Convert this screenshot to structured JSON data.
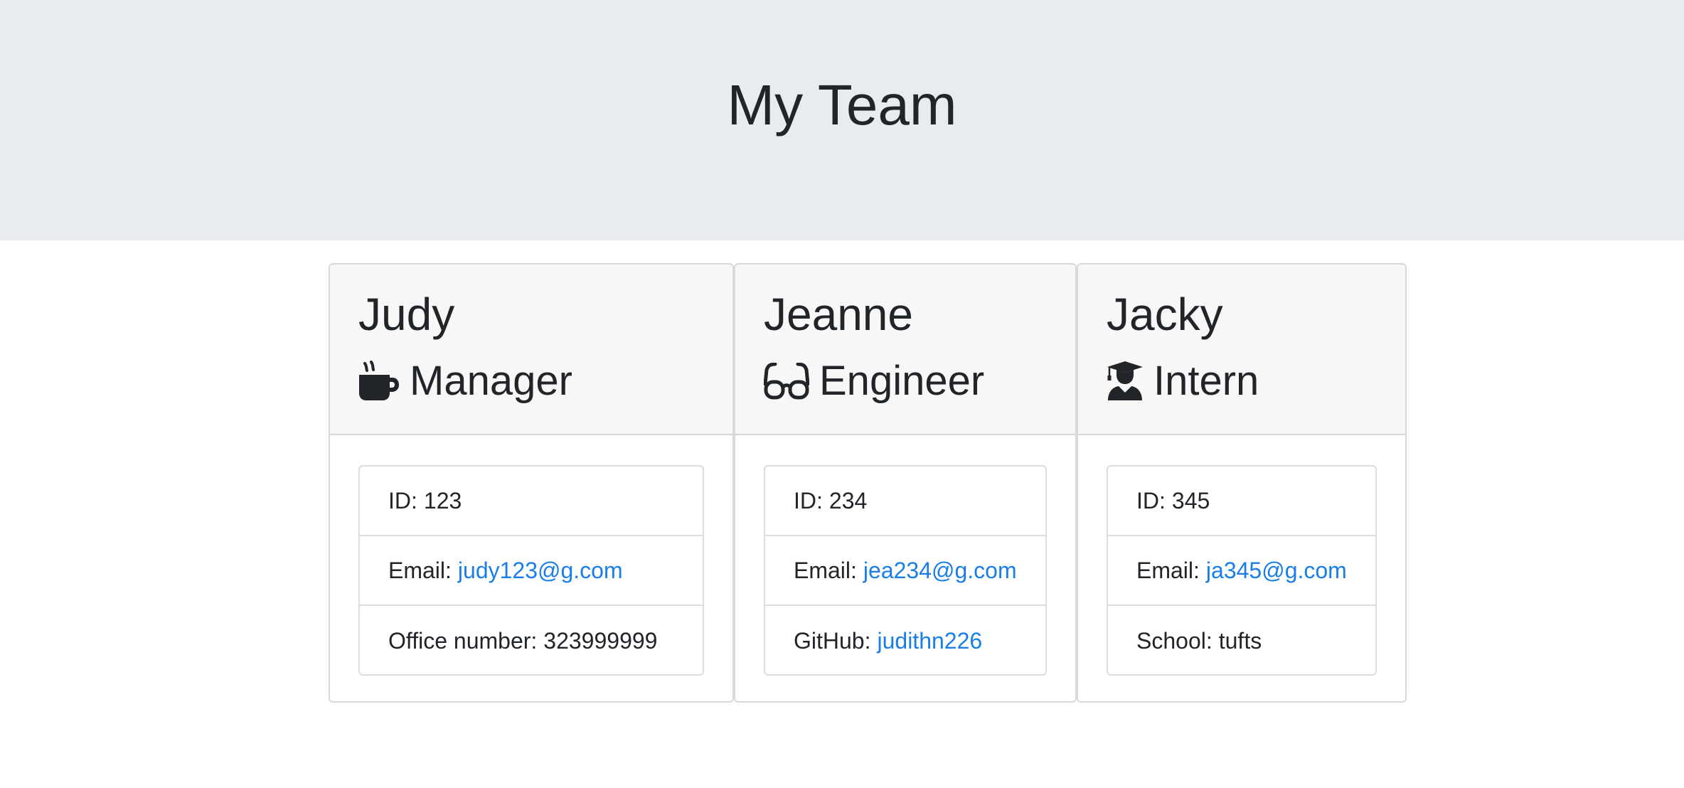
{
  "header": {
    "title": "My Team"
  },
  "cards": [
    {
      "name": "Judy",
      "role": "Manager",
      "icon": "mug-hot-icon",
      "rows": [
        {
          "label": "ID:",
          "value": "123"
        },
        {
          "label": "Email:",
          "value": "judy123@g.com"
        },
        {
          "label": "Office number:",
          "value": "323999999"
        }
      ]
    },
    {
      "name": "Jeanne",
      "role": "Engineer",
      "icon": "glasses-icon",
      "rows": [
        {
          "label": "ID:",
          "value": "234"
        },
        {
          "label": "Email:",
          "value": "jea234@g.com"
        },
        {
          "label": "GitHub:",
          "value": "judithn226"
        }
      ]
    },
    {
      "name": "Jacky",
      "role": "Intern",
      "icon": "graduate-icon",
      "rows": [
        {
          "label": "ID:",
          "value": "345"
        },
        {
          "label": "Email:",
          "value": "ja345@g.com"
        },
        {
          "label": "School:",
          "value": "tufts"
        }
      ]
    }
  ],
  "colors": {
    "jumbotron_bg": "#e9ecef",
    "card_header_bg": "#f7f7f7",
    "link": "#1a7ee8",
    "text": "#212529"
  }
}
